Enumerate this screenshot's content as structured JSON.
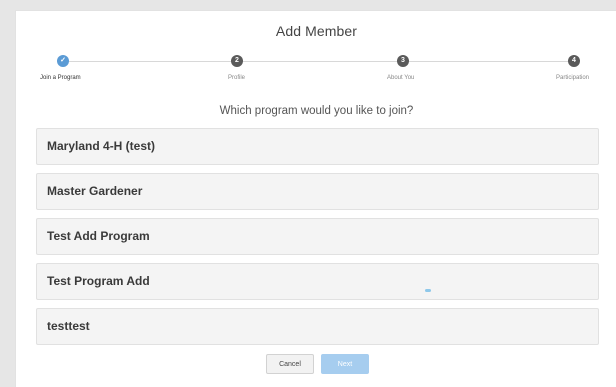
{
  "dialog": {
    "title": "Add Member",
    "question": "Which program would you like to join?"
  },
  "stepper": {
    "steps": [
      {
        "number": "✓",
        "label": "Join a Program",
        "state": "active"
      },
      {
        "number": "2",
        "label": "Profile",
        "state": "pending"
      },
      {
        "number": "3",
        "label": "About You",
        "state": "pending"
      },
      {
        "number": "4",
        "label": "Participation",
        "state": "pending"
      }
    ]
  },
  "programs": [
    {
      "name": "Maryland 4-H (test)"
    },
    {
      "name": "Master Gardener"
    },
    {
      "name": "Test Add Program"
    },
    {
      "name": "Test Program Add"
    },
    {
      "name": "testtest"
    }
  ],
  "buttons": {
    "cancel_label": "Cancel",
    "next_label": "Next"
  },
  "colors": {
    "accent": "#5b9bd5",
    "step_inactive": "#5a5a5a",
    "next_disabled": "#a6cdef"
  },
  "icons": {
    "step1": "check-icon"
  }
}
